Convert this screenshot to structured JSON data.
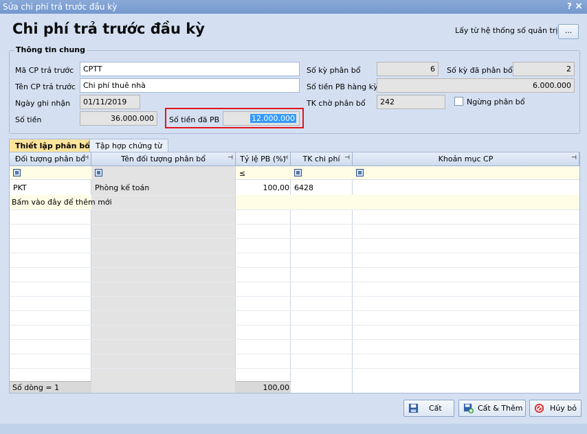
{
  "window": {
    "title": "Sửa chi phí trả trước đầu kỳ",
    "help": "?",
    "close": "×"
  },
  "header": {
    "title": "Chi phí trả trước đầu kỳ",
    "sys_label": "Lấy từ hệ thống số quản trị",
    "sys_button": "..."
  },
  "group": {
    "title": "Thông tin chung",
    "ma_cp_label": "Mã CP trả trước",
    "ma_cp_value": "CPTT",
    "ten_cp_label": "Tên CP trả trước",
    "ten_cp_value": "Chi phí thuê nhà",
    "ngay_label": "Ngày ghi nhận",
    "ngay_value": "01/11/2019",
    "so_tien_label": "Số tiền",
    "so_tien_value": "36.000.000",
    "so_tien_pb_label": "Số tiền đã PB",
    "so_tien_pb_value": "12.000.000",
    "so_ky_label": "Số kỳ phân bổ",
    "so_ky_value": "6",
    "so_ky_da_label": "Số kỳ đã phân bổ",
    "so_ky_da_value": "2",
    "pb_hang_ky_label": "Số tiền PB hàng kỳ",
    "pb_hang_ky_value": "6.000.000",
    "tk_cho_label": "TK chờ phân bổ",
    "tk_cho_value": "242",
    "ngung_label": "Ngừng phân bổ"
  },
  "tabs": {
    "active": "Thiết lập phân bổ",
    "inactive": "Tập hợp chứng từ"
  },
  "grid": {
    "columns": [
      "Đối tượng phân bổ",
      "Tên đối tượng phân bổ",
      "Tỷ lệ PB (%)",
      "TK chi phí",
      "Khoản mục CP"
    ],
    "pin": "⊣",
    "filter_op": "≤",
    "row": {
      "doi_tuong": "PKT",
      "ten": "Phòng kế toán",
      "ty_le": "100,00",
      "tk": "6428"
    },
    "add_hint": "Bấm vào đây để thêm mới",
    "footer_count": "Số dòng = 1",
    "footer_total": "100,00"
  },
  "buttons": {
    "save": "Cất",
    "save_add": "Cất & Thêm",
    "cancel": "Hủy bỏ"
  },
  "colors": {
    "highlight_border": "#e2141b",
    "active_tab": "#fde49b",
    "selection": "#3399ff"
  }
}
